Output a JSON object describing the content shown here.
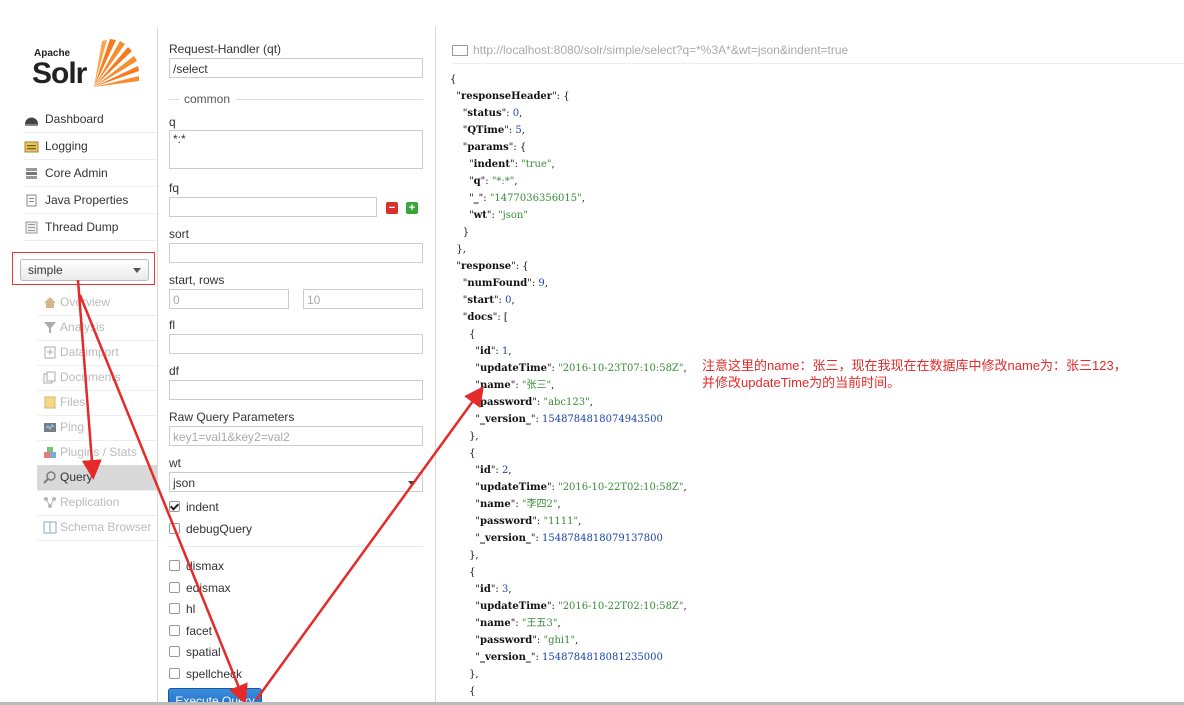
{
  "logo": {
    "top": "Apache",
    "main": "Solr"
  },
  "sidebar": {
    "items": [
      {
        "label": "Dashboard",
        "icon": "dashboard-icon"
      },
      {
        "label": "Logging",
        "icon": "logging-icon"
      },
      {
        "label": "Core Admin",
        "icon": "core-admin-icon"
      },
      {
        "label": "Java Properties",
        "icon": "java-properties-icon"
      },
      {
        "label": "Thread Dump",
        "icon": "thread-dump-icon"
      }
    ],
    "core_select": "simple",
    "core_items": [
      {
        "label": "Overview",
        "icon": "home-icon"
      },
      {
        "label": "Analysis",
        "icon": "filter-icon"
      },
      {
        "label": "Dataimport",
        "icon": "import-icon"
      },
      {
        "label": "Documents",
        "icon": "documents-icon"
      },
      {
        "label": "Files",
        "icon": "folder-icon"
      },
      {
        "label": "Ping",
        "icon": "ping-icon"
      },
      {
        "label": "Plugins / Stats",
        "icon": "plugins-icon"
      },
      {
        "label": "Query",
        "icon": "search-icon"
      },
      {
        "label": "Replication",
        "icon": "replication-icon"
      },
      {
        "label": "Schema Browser",
        "icon": "schema-icon"
      }
    ]
  },
  "form": {
    "request_handler_label": "Request-Handler (qt)",
    "request_handler_value": "/select",
    "common_legend": "common",
    "q_label": "q",
    "q_value": "*:*",
    "fq_label": "fq",
    "sort_label": "sort",
    "start_rows_label": "start, rows",
    "start_placeholder": "0",
    "rows_placeholder": "10",
    "fl_label": "fl",
    "df_label": "df",
    "raw_label": "Raw Query Parameters",
    "raw_placeholder": "key1=val1&key2=val2",
    "wt_label": "wt",
    "wt_value": "json",
    "indent_label": "indent",
    "debug_label": "debugQuery",
    "dismax_label": "dismax",
    "edismax_label": "edismax",
    "hl_label": "hl",
    "facet_label": "facet",
    "spatial_label": "spatial",
    "spellcheck_label": "spellcheck",
    "execute_label": "Execute Query",
    "remove_symbol": "−",
    "add_symbol": "+"
  },
  "response": {
    "url": "http://localhost:8080/solr/simple/select?q=*%3A*&wt=json&indent=true",
    "status": "0",
    "qtime": "5",
    "indent": "\"true\"",
    "q": "\"*:*\"",
    "underscore": "\"1477036356015\"",
    "wt": "\"json\"",
    "num_found": "9",
    "start": "0",
    "docs": [
      {
        "id": "1",
        "updateTime": "\"2016-10-23T07:10:58Z\"",
        "name": "\"张三\"",
        "password": "\"abc123\"",
        "version": "1548784818074943500"
      },
      {
        "id": "2",
        "updateTime": "\"2016-10-22T02:10:58Z\"",
        "name": "\"李四2\"",
        "password": "\"1111\"",
        "version": "1548784818079137800"
      },
      {
        "id": "3",
        "updateTime": "\"2016-10-22T02:10:58Z\"",
        "name": "\"王五3\"",
        "password": "\"ghi1\"",
        "version": "1548784818081235000"
      }
    ]
  },
  "annotation": {
    "line1": "注意这里的name：张三，现在我现在在数据库中修改name为：张三123，",
    "line2": "并修改updateTime为的当前时间。",
    "color": "#e52a2a"
  }
}
